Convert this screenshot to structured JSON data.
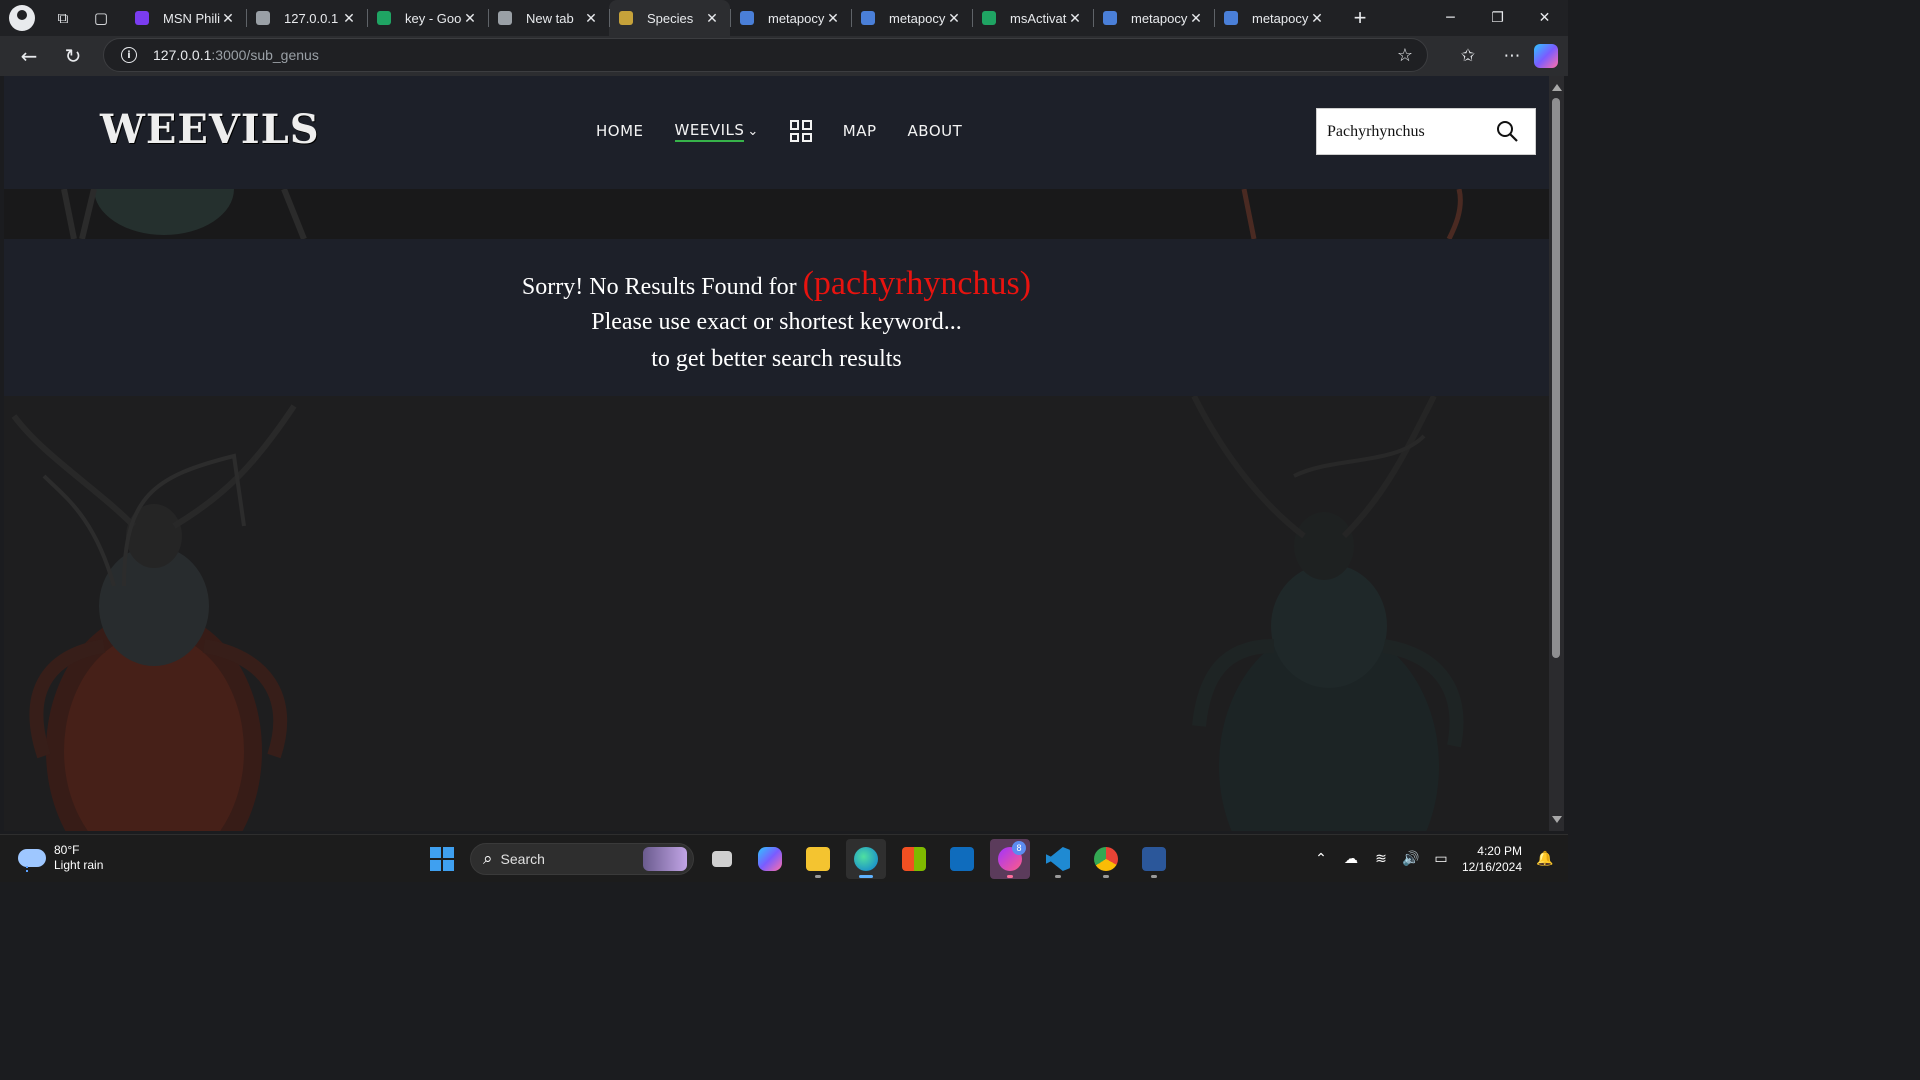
{
  "browser": {
    "tabs": [
      {
        "title": "MSN Philip",
        "color": "#7a3cf0"
      },
      {
        "title": "127.0.0.1",
        "color": "#9aa0a6"
      },
      {
        "title": "key - Goog",
        "color": "#1fa463"
      },
      {
        "title": "New tab",
        "color": "#9aa0a6"
      },
      {
        "title": "Species",
        "color": "#c6a23a"
      },
      {
        "title": "metapocyr",
        "color": "#4a7fd8"
      },
      {
        "title": "metapocyr",
        "color": "#4a7fd8"
      },
      {
        "title": "msActivato",
        "color": "#1fa463"
      },
      {
        "title": "metapocyr",
        "color": "#4a7fd8"
      },
      {
        "title": "metapocyr",
        "color": "#4a7fd8"
      }
    ],
    "active_tab_index": 4,
    "close_glyph": "✕",
    "new_tab_glyph": "+",
    "url_host": "127.0.0.1",
    "url_rest": ":3000/sub_genus",
    "window_controls": [
      "─",
      "❐",
      "✕"
    ]
  },
  "site": {
    "logo": "WEEVILS",
    "nav": {
      "home": "HOME",
      "weevils": "WEEVILS",
      "map": "MAP",
      "about": "ABOUT"
    },
    "search_value": "Pachyrhynchus",
    "accent_color": "#37b34a"
  },
  "message": {
    "prefix": "Sorry! No Results Found for ",
    "term": "(pachyrhynchus)",
    "line2": "Please use exact or shortest keyword...",
    "line3": "to get better search results",
    "term_color": "#e8130f"
  },
  "taskbar": {
    "weather_temp": "80°F",
    "weather_desc": "Light rain",
    "search_label": "Search",
    "messenger_badge": "8",
    "time": "4:20 PM",
    "date": "12/16/2024"
  }
}
